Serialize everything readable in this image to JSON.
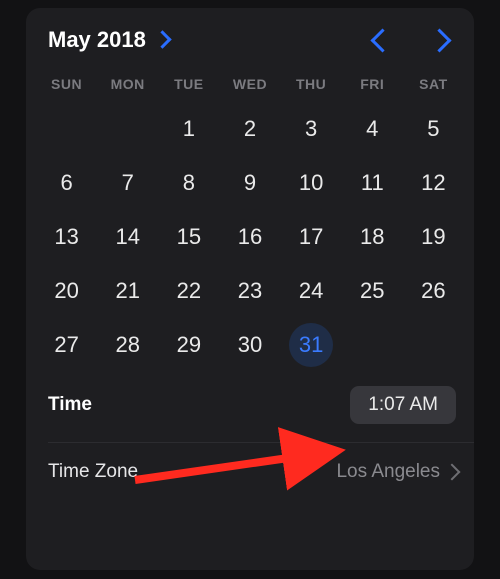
{
  "header": {
    "month_year": "May 2018"
  },
  "weekdays": [
    "SUN",
    "MON",
    "TUE",
    "WED",
    "THU",
    "FRI",
    "SAT"
  ],
  "calendar": {
    "first_weekday_index": 2,
    "days_in_month": 31,
    "selected_day": 31
  },
  "time": {
    "label": "Time",
    "value": "1:07 AM"
  },
  "timezone": {
    "label": "Time Zone",
    "value": "Los Angeles"
  }
}
